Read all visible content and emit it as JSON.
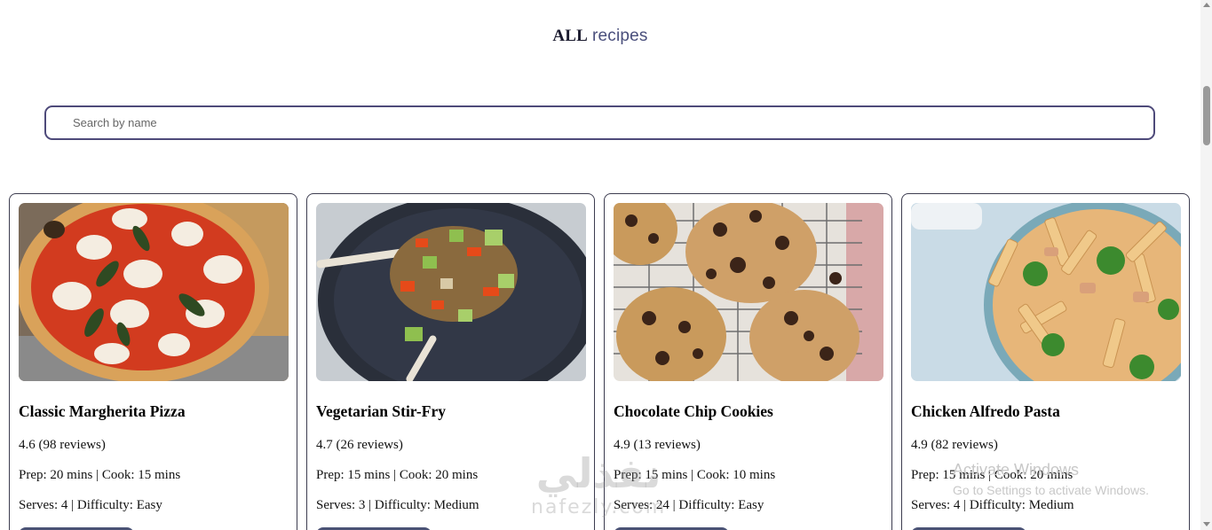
{
  "header": {
    "title_bold": "ALL",
    "title_rest": "recipes"
  },
  "search": {
    "placeholder": "Search by name",
    "value": ""
  },
  "recipes": [
    {
      "name": "Classic Margherita Pizza",
      "rating": "4.6 (98 reviews)",
      "times": "Prep: 20 mins | Cook: 15 mins",
      "meta": "Serves: 4 | Difficulty: Easy"
    },
    {
      "name": "Vegetarian Stir-Fry",
      "rating": "4.7 (26 reviews)",
      "times": "Prep: 15 mins | Cook: 20 mins",
      "meta": "Serves: 3 | Difficulty: Medium"
    },
    {
      "name": "Chocolate Chip Cookies",
      "rating": "4.9 (13 reviews)",
      "times": "Prep: 15 mins | Cook: 10 mins",
      "meta": "Serves: 24 | Difficulty: Easy"
    },
    {
      "name": "Chicken Alfredo Pasta",
      "rating": "4.9 (82 reviews)",
      "times": "Prep: 15 mins | Cook: 20 mins",
      "meta": "Serves: 4 | Difficulty: Medium"
    }
  ],
  "overlay": {
    "activate_title": "Activate Windows",
    "activate_sub": "Go to Settings to activate Windows.",
    "brand_arabic": "نفذلي",
    "brand_latin": "nafezly.com"
  },
  "colors": {
    "accent": "#4a5275",
    "search_border": "#4e4a7a",
    "title_accent": "#4a4f7c"
  }
}
